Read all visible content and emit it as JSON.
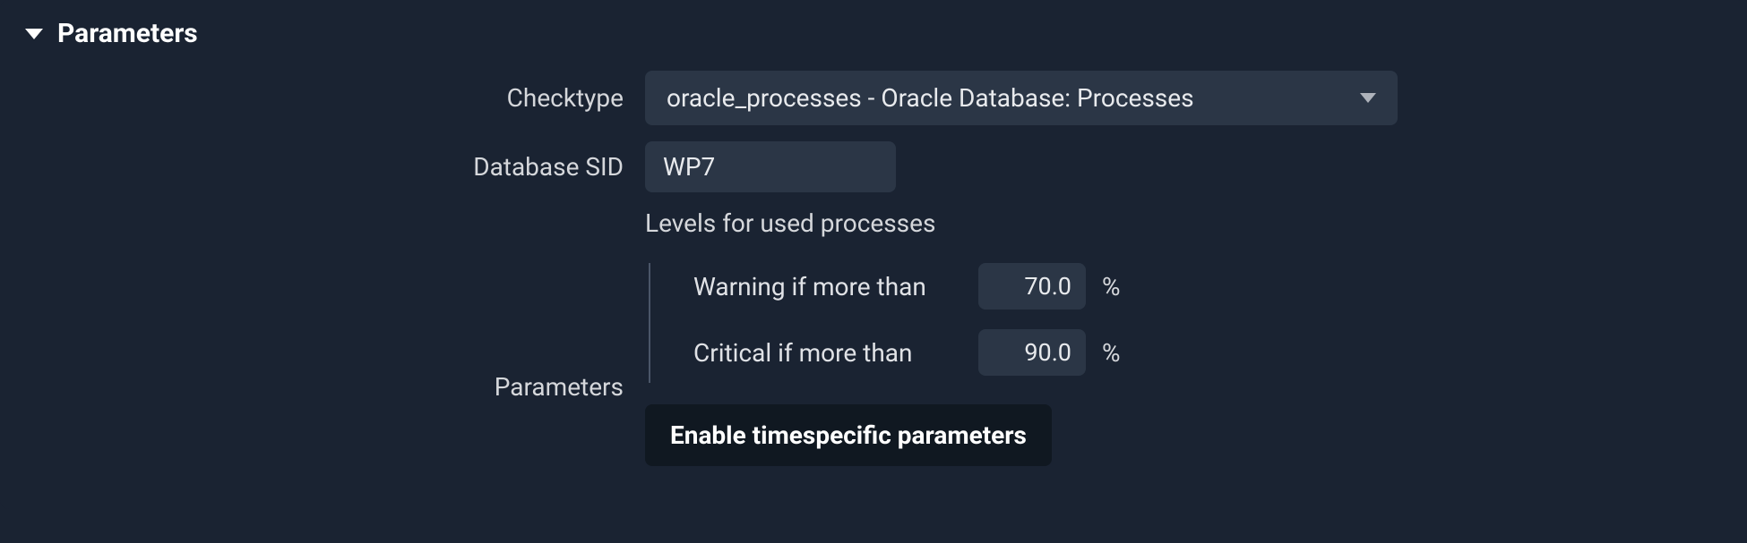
{
  "panel": {
    "title": "Parameters"
  },
  "form": {
    "checktype": {
      "label": "Checktype",
      "value": "oracle_processes - Oracle Database: Processes"
    },
    "sid": {
      "label": "Database SID",
      "value": "WP7"
    },
    "parameters": {
      "label": "Parameters",
      "levels_title": "Levels for used processes",
      "warning": {
        "label": "Warning if more than",
        "value": "70.0",
        "unit": "%"
      },
      "critical": {
        "label": "Critical if more than",
        "value": "90.0",
        "unit": "%"
      },
      "button": "Enable timespecific parameters"
    }
  }
}
